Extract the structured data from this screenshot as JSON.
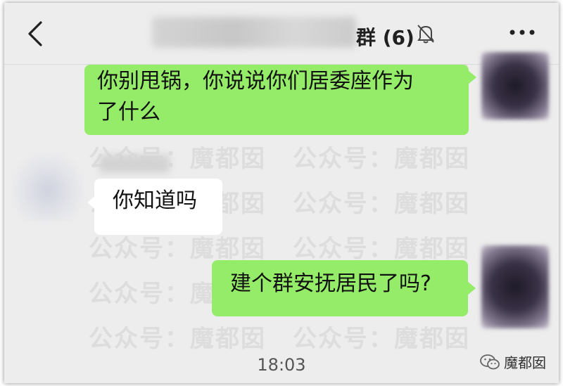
{
  "header": {
    "title": "群 (6)",
    "back_icon": "chevron-left-icon",
    "mute_icon": "bell-off-icon",
    "more_icon": "more-dots-icon"
  },
  "watermark_text": "公众号：魔都囡",
  "messages": [
    {
      "side": "right",
      "text_line1": "你别甩锅，你说说你们居委座作为",
      "text_line2": "了什么"
    },
    {
      "side": "left",
      "text": "你知道吗"
    },
    {
      "side": "right",
      "text": "建个群安抚居民了吗?"
    }
  ],
  "timestamp": "18:03",
  "source": {
    "icon": "wechat-icon",
    "label": "魔都囡"
  },
  "colors": {
    "background": "#ededed",
    "bubble_mine": "#95ec69",
    "bubble_other": "#ffffff"
  }
}
